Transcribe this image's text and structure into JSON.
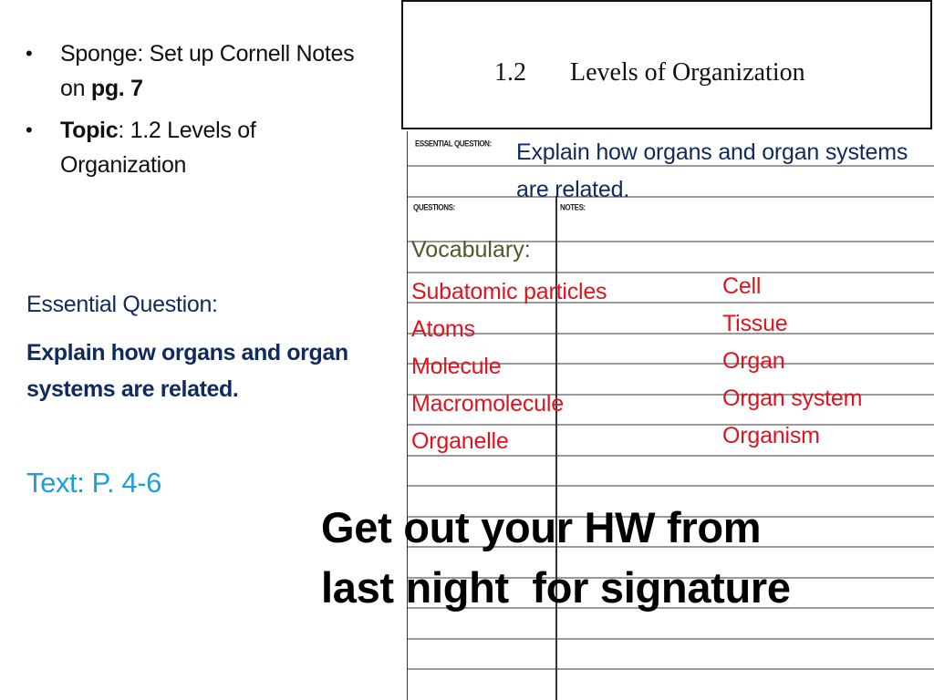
{
  "left_panel": {
    "bullets": [
      {
        "prefix": "",
        "prefix_bold": "",
        "text": "Sponge: Set up Cornell Notes on ",
        "suffix_bold": "pg. 7"
      },
      {
        "prefix_bold": "Topic",
        "text": ": 1.2 Levels of Organization",
        "suffix_bold": ""
      }
    ],
    "essential_question_label": "Essential Question:",
    "essential_question_text": "Explain how organs and organ systems are related.",
    "text_reference": "Text: P. 4-6"
  },
  "worksheet": {
    "title_number": "1.2",
    "title_text": "Levels of Organization",
    "essential_question_header": "ESSENTIAL QUESTION:",
    "questions_header": "QUESTIONS:",
    "notes_header": "NOTES:",
    "essential_question_text": "Explain how organs and organ systems are related.",
    "vocabulary_label": "Vocabulary:",
    "vocabulary_terms": [
      "Subatomic particles",
      "Atoms",
      "Molecule",
      "Macromolecule",
      "Organelle"
    ],
    "organization_levels": [
      "Cell",
      "Tissue",
      "Organ",
      "Organ system",
      "Organism"
    ]
  },
  "announcement": {
    "line1": "Get out your HW from",
    "line2": "last night  for signature"
  },
  "colors": {
    "navy": "#0f2a5c",
    "red": "#e0141e",
    "light_blue": "#1f9fd8",
    "olive": "#4a5a2a"
  }
}
